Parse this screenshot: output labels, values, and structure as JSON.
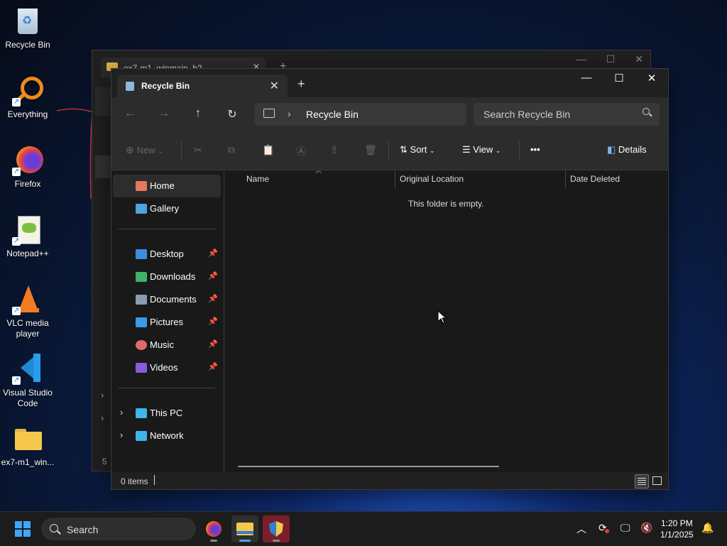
{
  "desktop": {
    "icons": [
      {
        "label": "Recycle Bin",
        "icon": "recycle-bin-icon"
      },
      {
        "label": "Everything",
        "icon": "everything-search-icon"
      },
      {
        "label": "Firefox",
        "icon": "firefox-icon"
      },
      {
        "label": "Notepad++",
        "icon": "notepad-plus-plus-icon"
      },
      {
        "label": "VLC media player",
        "icon": "vlc-icon"
      },
      {
        "label": "Visual Studio Code",
        "icon": "vscode-icon"
      },
      {
        "label": "ex7-m1_win...",
        "icon": "folder-icon"
      }
    ]
  },
  "background_window": {
    "tab_title": "ex7-m1_winmain_b2"
  },
  "window": {
    "tab_title": "Recycle Bin",
    "new_tab": "+",
    "controls": {
      "minimize": "—",
      "maximize": "☐",
      "close": "✕"
    },
    "nav": {
      "back": "←",
      "forward": "→",
      "up": "↑",
      "refresh": "↻"
    },
    "address": {
      "crumb_sep": "›",
      "crumb": "Recycle Bin"
    },
    "search": {
      "placeholder": "Search Recycle Bin"
    },
    "toolbar": {
      "new_label": "New",
      "sort_label": "Sort",
      "view_label": "View",
      "more_label": "•••",
      "details_label": "Details"
    },
    "sidebar": {
      "quick": [
        {
          "label": "Home",
          "color": "#e8785a",
          "selected": true
        },
        {
          "label": "Gallery",
          "color": "#4fa3e0"
        }
      ],
      "pinned": [
        {
          "label": "Desktop",
          "color": "#3c8ee0"
        },
        {
          "label": "Downloads",
          "color": "#3fb36b"
        },
        {
          "label": "Documents",
          "color": "#8a9bb0"
        },
        {
          "label": "Pictures",
          "color": "#3a9be8"
        },
        {
          "label": "Music",
          "color": "#e06b6b"
        },
        {
          "label": "Videos",
          "color": "#8a5ad8"
        }
      ],
      "locations": [
        {
          "label": "This PC",
          "color": "#3fb6e8"
        },
        {
          "label": "Network",
          "color": "#3fb6e8"
        }
      ],
      "pin_glyph": "📌",
      "expand_glyph": "›"
    },
    "columns": [
      "Name",
      "Original Location",
      "Date Deleted"
    ],
    "empty_message": "This folder is empty.",
    "status": {
      "count": "0 items"
    }
  },
  "taskbar": {
    "search_placeholder": "Search",
    "apps": [
      "firefox-icon",
      "file-explorer-icon",
      "security-shield-icon"
    ],
    "time": "1:20 PM",
    "date": "1/1/2025"
  }
}
